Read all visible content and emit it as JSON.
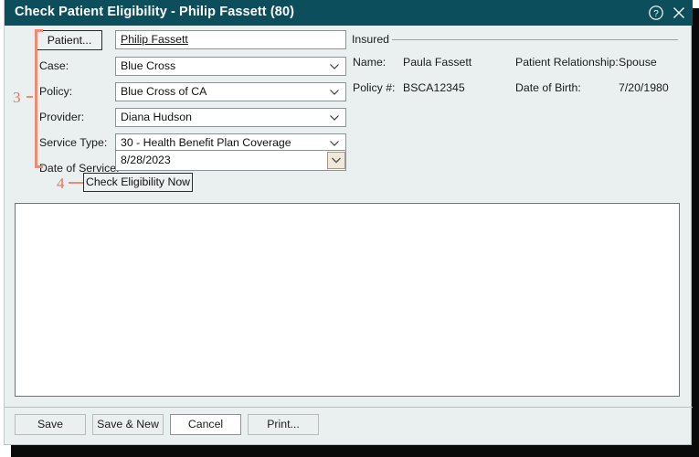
{
  "window": {
    "title": "Check Patient Eligibility - Philip Fassett (80)",
    "help_icon": "help-circle-icon",
    "close_icon": "close-icon"
  },
  "form": {
    "patient_button": "Patient...",
    "patient_name": "Philip Fassett",
    "fields": [
      {
        "label": "Case:",
        "value": "Blue Cross"
      },
      {
        "label": "Policy:",
        "value": "Blue Cross of CA"
      },
      {
        "label": "Provider:",
        "value": "Diana Hudson"
      },
      {
        "label": "Service Type:",
        "value": "30 - Health Benefit Plan Coverage"
      },
      {
        "label": "Date of Service:",
        "value": "8/28/2023"
      }
    ],
    "check_button": "Check Eligibility Now"
  },
  "insured": {
    "legend": "Insured",
    "rows": [
      {
        "label": "Name:",
        "value": "Paula Fassett",
        "label2": "Patient Relationship:",
        "value2": "Spouse"
      },
      {
        "label": "Policy #:",
        "value": "BSCA12345",
        "label2": "Date of Birth:",
        "value2": "7/20/1980"
      }
    ]
  },
  "footer": {
    "buttons": [
      {
        "label": "Save"
      },
      {
        "label": "Save & New"
      },
      {
        "label": "Cancel"
      },
      {
        "label": "Print..."
      }
    ]
  },
  "annotations": [
    {
      "number": "3"
    },
    {
      "number": "4"
    }
  ],
  "colors": {
    "titlebar": "#0c4e5c",
    "body": "#eaeff0",
    "annotation": "#e8765a"
  }
}
